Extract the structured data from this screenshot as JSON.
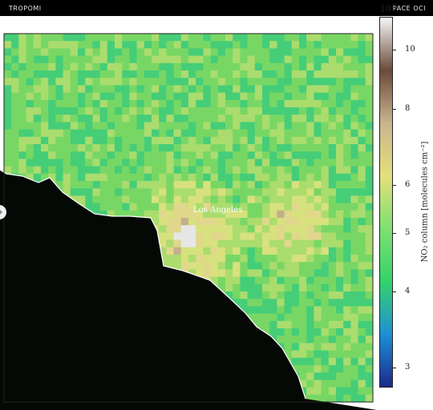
{
  "header": {
    "left_label": "TROPOMI",
    "right_label": "PACE OCI"
  },
  "map": {
    "city_label": "Los Angeles",
    "ocean_color": "#050905"
  },
  "colorbar": {
    "exponent_base": "10",
    "exponent_power": "16",
    "label": "NO₂ column [molecules cm⁻²]",
    "ticks": [
      {
        "value": 10,
        "label": "10"
      },
      {
        "value": 8,
        "label": "8"
      },
      {
        "value": 6,
        "label": "6"
      },
      {
        "value": 5,
        "label": "5"
      },
      {
        "value": 4,
        "label": "4"
      },
      {
        "value": 3,
        "label": "3"
      }
    ],
    "colors": [
      "#1a2a8c",
      "#1f8fd6",
      "#35d36a",
      "#7fe071",
      "#e4e07c",
      "#c9b48f",
      "#6b4a3a",
      "#f6f6f6"
    ]
  }
}
